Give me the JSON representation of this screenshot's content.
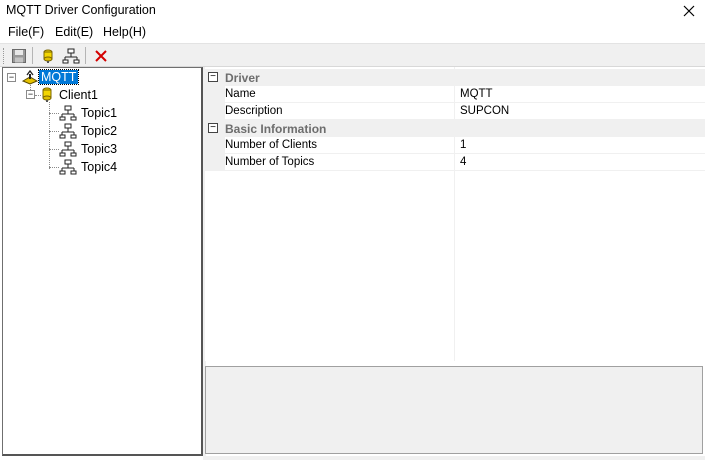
{
  "window": {
    "title": "MQTT Driver Configuration"
  },
  "menu": [
    {
      "label": "File(F)"
    },
    {
      "label": "Edit(E)"
    },
    {
      "label": "Help(H)"
    }
  ],
  "toolbar": {
    "icons": [
      "save-icon",
      "add-client-icon",
      "add-topic-icon",
      "delete-icon"
    ],
    "colors": {
      "delete": "#d40000",
      "client": "#e6c200"
    }
  },
  "tree": {
    "root": {
      "label": "MQTT"
    },
    "clients": [
      {
        "label": "Client1",
        "topics": [
          {
            "label": "Topic1"
          },
          {
            "label": "Topic2"
          },
          {
            "label": "Topic3"
          },
          {
            "label": "Topic4"
          }
        ]
      }
    ],
    "selection_color": "#0078d7"
  },
  "properties": {
    "categories": [
      {
        "label": "Driver",
        "rows": [
          {
            "name": "Name",
            "value": "MQTT"
          },
          {
            "name": "Description",
            "value": "SUPCON"
          }
        ]
      },
      {
        "label": "Basic Information",
        "rows": [
          {
            "name": "Number of Clients",
            "value": "1"
          },
          {
            "name": "Number of Topics",
            "value": "4"
          }
        ]
      }
    ]
  }
}
